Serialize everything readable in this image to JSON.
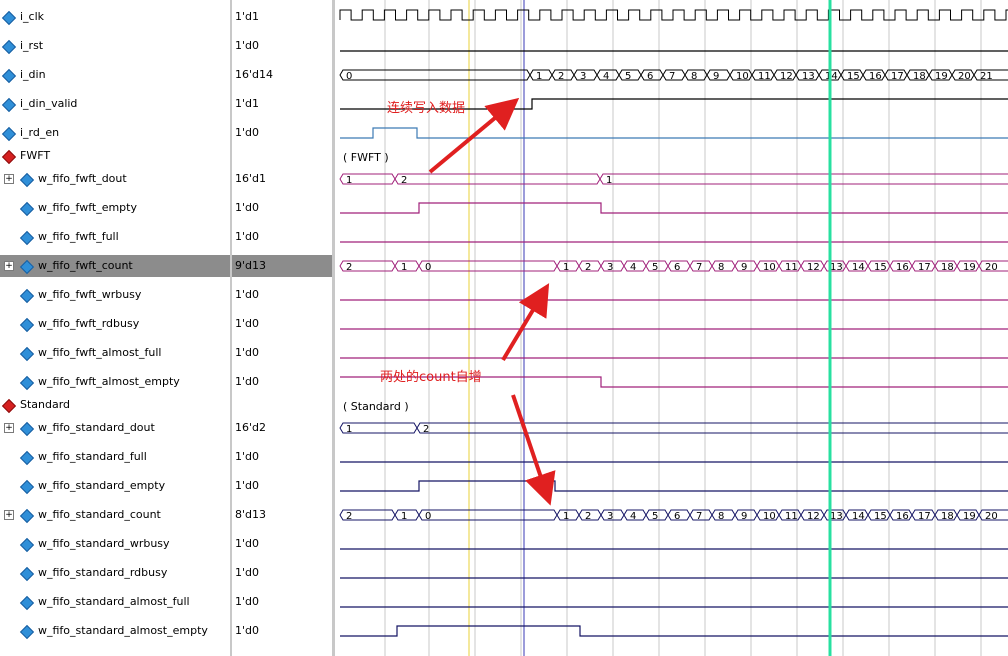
{
  "signals": [
    {
      "name": "i_clk",
      "value": "1'd1",
      "icon": "blue",
      "expand": false,
      "indent": false
    },
    {
      "name": "i_rst",
      "value": "1'd0",
      "icon": "blue",
      "expand": false,
      "indent": false
    },
    {
      "name": "i_din",
      "value": "16'd14",
      "icon": "blue",
      "expand": false,
      "indent": false
    },
    {
      "name": "i_din_valid",
      "value": "1'd1",
      "icon": "blue",
      "expand": false,
      "indent": false
    },
    {
      "name": "i_rd_en",
      "value": "1'd0",
      "icon": "blue",
      "expand": false,
      "indent": false
    },
    {
      "name": "FWFT",
      "value": "",
      "icon": "red",
      "expand": false,
      "indent": false
    },
    {
      "name": "w_fifo_fwft_dout",
      "value": "16'd1",
      "icon": "blue",
      "expand": true,
      "indent": true
    },
    {
      "name": "w_fifo_fwft_empty",
      "value": "1'd0",
      "icon": "blue",
      "expand": false,
      "indent": true
    },
    {
      "name": "w_fifo_fwft_full",
      "value": "1'd0",
      "icon": "blue",
      "expand": false,
      "indent": true
    },
    {
      "name": "w_fifo_fwft_count",
      "value": "9'd13",
      "icon": "blue",
      "expand": true,
      "indent": true,
      "selected": true
    },
    {
      "name": "w_fifo_fwft_wrbusy",
      "value": "1'd0",
      "icon": "blue",
      "expand": false,
      "indent": true
    },
    {
      "name": "w_fifo_fwft_rdbusy",
      "value": "1'd0",
      "icon": "blue",
      "expand": false,
      "indent": true
    },
    {
      "name": "w_fifo_fwft_almost_full",
      "value": "1'd0",
      "icon": "blue",
      "expand": false,
      "indent": true
    },
    {
      "name": "w_fifo_fwft_almost_empty",
      "value": "1'd0",
      "icon": "blue",
      "expand": false,
      "indent": true
    },
    {
      "name": "Standard",
      "value": "",
      "icon": "red",
      "expand": false,
      "indent": false
    },
    {
      "name": "w_fifo_standard_dout",
      "value": "16'd2",
      "icon": "blue",
      "expand": true,
      "indent": true
    },
    {
      "name": "w_fifo_standard_full",
      "value": "1'd0",
      "icon": "blue",
      "expand": false,
      "indent": true
    },
    {
      "name": "w_fifo_standard_empty",
      "value": "1'd0",
      "icon": "blue",
      "expand": false,
      "indent": true
    },
    {
      "name": "w_fifo_standard_count",
      "value": "8'd13",
      "icon": "blue",
      "expand": true,
      "indent": true
    },
    {
      "name": "w_fifo_standard_wrbusy",
      "value": "1'd0",
      "icon": "blue",
      "expand": false,
      "indent": true
    },
    {
      "name": "w_fifo_standard_rdbusy",
      "value": "1'd0",
      "icon": "blue",
      "expand": false,
      "indent": true
    },
    {
      "name": "w_fifo_standard_almost_full",
      "value": "1'd0",
      "icon": "blue",
      "expand": false,
      "indent": true
    },
    {
      "name": "w_fifo_standard_almost_empty",
      "value": "1'd0",
      "icon": "blue",
      "expand": false,
      "indent": true
    }
  ],
  "group_labels": {
    "fwft": "( FWFT )",
    "standard": "( Standard )"
  },
  "annotations": {
    "write_note": "连续写入数据",
    "count_note": "两处的count自增"
  },
  "buses": {
    "din": [
      "0",
      "1",
      "2",
      "3",
      "4",
      "5",
      "6",
      "7",
      "8",
      "9",
      "10",
      "11",
      "12",
      "13",
      "14",
      "15",
      "16",
      "17",
      "18",
      "19",
      "20",
      "21"
    ],
    "fwft_dout": [
      "1",
      "2",
      "1"
    ],
    "fwft_count": [
      "2",
      "1",
      "0",
      "1",
      "2",
      "3",
      "4",
      "5",
      "6",
      "7",
      "8",
      "9",
      "10",
      "11",
      "12",
      "13",
      "14",
      "15",
      "16",
      "17",
      "18",
      "19",
      "20"
    ],
    "standard_dout": [
      "1",
      "2"
    ],
    "standard_count": [
      "2",
      "1",
      "0",
      "1",
      "2",
      "3",
      "4",
      "5",
      "6",
      "7",
      "8",
      "9",
      "10",
      "11",
      "12",
      "13",
      "14",
      "15",
      "16",
      "17",
      "18",
      "19",
      "20"
    ]
  },
  "colors": {
    "clk": "#000000",
    "fwft": "#a0207a",
    "standard": "#141464",
    "rd_en": "#3c7ab4",
    "arrow": "#e02020",
    "cursor": "#28e0a0",
    "marker_yellow": "#e8d23a",
    "marker_blue": "#3a3ab4",
    "note_text": "#e02020"
  }
}
